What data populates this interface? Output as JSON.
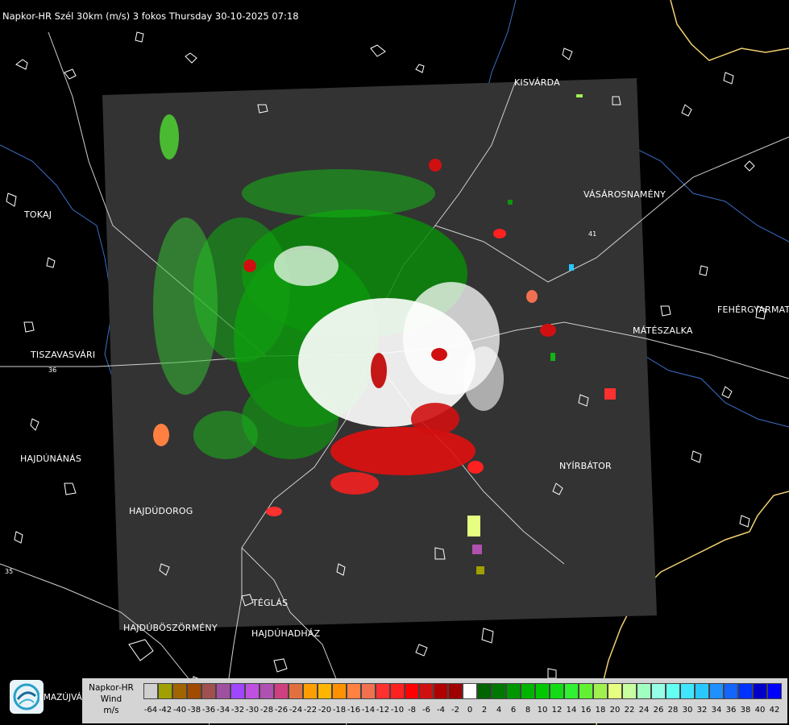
{
  "title": "Napkor-HR Szél 30km (m/s) 3 fokos Thursday 30-10-2025 07:18",
  "cities": [
    {
      "name": "KISVÁRDA",
      "id": "kisvarda"
    },
    {
      "name": "VÁSÁROSNAMÉNY",
      "id": "vasarosnameny"
    },
    {
      "name": "TOKAJ",
      "id": "tokaj"
    },
    {
      "name": "FEHÉRGYARMAT",
      "id": "fehergyarmat"
    },
    {
      "name": "MÁTÉSZALKA",
      "id": "mateszalka"
    },
    {
      "name": "TISZAVASVÁRI",
      "id": "tiszavasvari"
    },
    {
      "name": "HAJDÚNÁNÁS",
      "id": "hajdunanas"
    },
    {
      "name": "NYÍRBÁTOR",
      "id": "nyirbator"
    },
    {
      "name": "HAJDÚDOROG",
      "id": "hajdudorog"
    },
    {
      "name": "TÉGLÁS",
      "id": "teglas"
    },
    {
      "name": "HAJDÚBÖSZÖRMÉNY",
      "id": "hajduboszormeny"
    },
    {
      "name": "HAJDÚHADHÁZ",
      "id": "hajduhadhaz"
    }
  ],
  "road_numbers": [
    "36",
    "35",
    "41"
  ],
  "logo_text": "LMAZÚJVÁR",
  "legend": {
    "label_line1": "Napkor-HR",
    "label_line2": "Wind",
    "label_line3": "m/s",
    "scale_values": [
      "-64",
      "-42",
      "-40",
      "-38",
      "-36",
      "-34",
      "-32",
      "-30",
      "-28",
      "-26",
      "-24",
      "-22",
      "-20",
      "-18",
      "-16",
      "-14",
      "-12",
      "-10",
      "-8",
      "-6",
      "-4",
      "-2",
      "0",
      "2",
      "4",
      "6",
      "8",
      "10",
      "12",
      "14",
      "16",
      "18",
      "20",
      "22",
      "24",
      "26",
      "28",
      "30",
      "32",
      "34",
      "36",
      "38",
      "40",
      "42"
    ],
    "colors": [
      "#d0d0d0",
      "#a0a000",
      "#a06400",
      "#a04b00",
      "#a05050",
      "#a050a0",
      "#a046ff",
      "#c050e0",
      "#b050b0",
      "#d04080",
      "#e07040",
      "#ff9e00",
      "#ffb400",
      "#ff9000",
      "#ff8040",
      "#f07050",
      "#ff3030",
      "#ff2020",
      "#ff0000",
      "#d01010",
      "#b00000",
      "#a00000",
      "#ffffff",
      "#006400",
      "#007800",
      "#009600",
      "#00b400",
      "#00c800",
      "#14dc14",
      "#32f032",
      "#64f032",
      "#a0f050",
      "#e6ff80",
      "#c8ffa0",
      "#a0ffc0",
      "#96ffe6",
      "#64fff0",
      "#40e6ff",
      "#28c8ff",
      "#1e90ff",
      "#1464ff",
      "#0032ff",
      "#0000c8",
      "#0000ff"
    ]
  },
  "colors": {
    "background": "#000000",
    "radar_area": "#333333",
    "outline": "#ffffff",
    "border": "#f0d070",
    "river": "#3c6ec8"
  }
}
